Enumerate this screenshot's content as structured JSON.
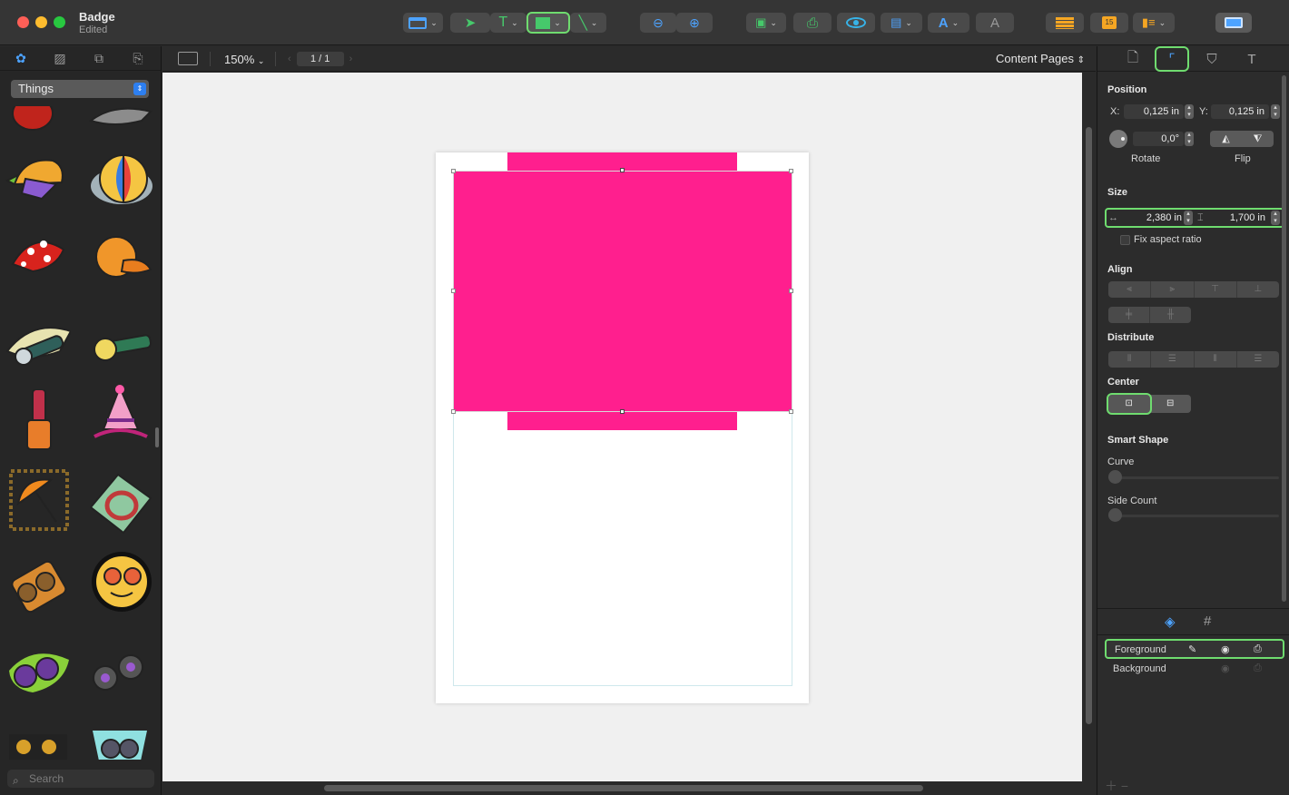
{
  "window": {
    "title": "Badge",
    "subtitle": "Edited"
  },
  "toolbar": {
    "buttons": [
      "page-layout",
      "select-tool",
      "text-tool",
      "shape-tool",
      "line-tool",
      "zoom-out",
      "zoom-in",
      "insert-object",
      "print",
      "preview",
      "insert-field",
      "text-style",
      "font",
      "layout-grid",
      "calendar",
      "contacts",
      "window-view"
    ]
  },
  "library": {
    "category": "Things",
    "search_placeholder": "Search",
    "clips": [
      "boxing-glove",
      "fish",
      "cap",
      "beach-ball",
      "bandana",
      "orange-cap",
      "flashlight",
      "flashlight-green",
      "lipstick",
      "birthday-hat",
      "umbrella",
      "lasso",
      "binoculars-a",
      "sunglasses-face",
      "binoculars-b",
      "binoculars-c",
      "binoculars-d",
      "binoculars-e"
    ]
  },
  "canvas_bar": {
    "zoom": "150%",
    "page_indicator": "1 / 1",
    "content_pages": "Content Pages"
  },
  "colors": {
    "shape_fill": "#ff1f8e",
    "accent": "#4da3ff",
    "highlight": "#6fdc6f"
  },
  "inspector": {
    "position": {
      "title": "Position",
      "x_label": "X:",
      "x_value": "0,125 in",
      "y_label": "Y:",
      "y_value": "0,125 in",
      "rotate_value": "0,0°",
      "rotate_label": "Rotate",
      "flip_label": "Flip"
    },
    "size": {
      "title": "Size",
      "width_value": "2,380 in",
      "height_value": "1,700 in",
      "fix_aspect_label": "Fix aspect ratio"
    },
    "align_title": "Align",
    "distribute_title": "Distribute",
    "center_title": "Center",
    "smart_shape": {
      "title": "Smart Shape",
      "curve_label": "Curve",
      "side_count_label": "Side Count"
    },
    "layers": [
      {
        "name": "Foreground"
      },
      {
        "name": "Background"
      }
    ]
  }
}
